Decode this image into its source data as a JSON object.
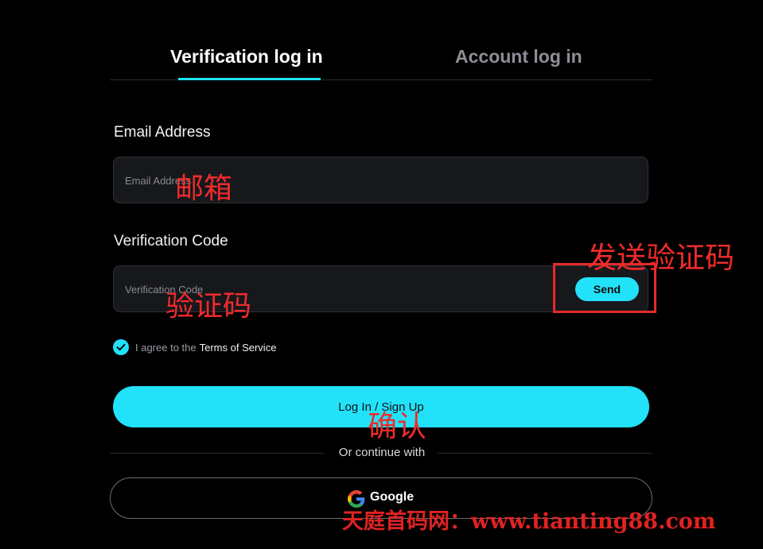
{
  "tabs": {
    "verification": "Verification log in",
    "account": "Account log in"
  },
  "email": {
    "label": "Email Address",
    "placeholder": "Email Address",
    "annotation": "邮箱"
  },
  "code": {
    "label": "Verification Code",
    "placeholder": "Verification Code",
    "annotation": "验证码",
    "send_label": "Send",
    "send_annotation": "发送验证码"
  },
  "agree": {
    "text": "I agree to the",
    "link": "Terms of Service"
  },
  "submit": {
    "label": "Log In / Sign Up",
    "annotation": "确认"
  },
  "divider_text": "Or continue with",
  "google": {
    "label": "Google"
  },
  "watermark": "天庭首码网：www.tianting88.com",
  "colors": {
    "accent": "#22e2f9",
    "background": "#000000",
    "input_bg": "#17181c",
    "annotation": "#ef2b2b"
  }
}
